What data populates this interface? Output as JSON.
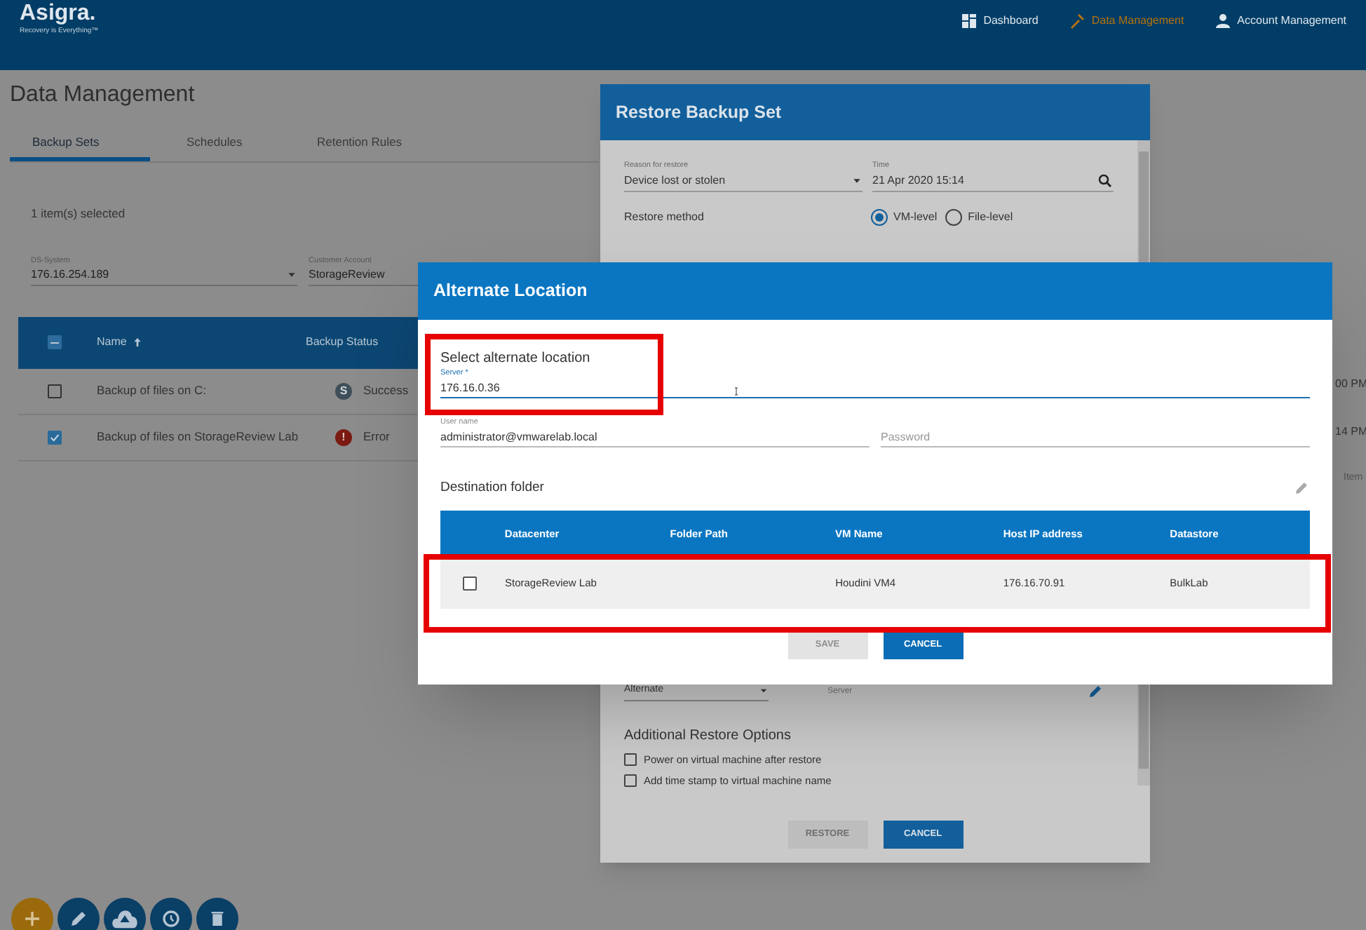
{
  "header": {
    "logo": "Asigra.",
    "tagline": "Recovery is Everything™",
    "nav": [
      {
        "label": "Dashboard",
        "kind": "grid",
        "selected": false
      },
      {
        "label": "Data Management",
        "kind": "tools",
        "selected": true
      },
      {
        "label": "Account Management",
        "kind": "person",
        "selected": false
      }
    ]
  },
  "page_title": "Data Management",
  "tabs": [
    {
      "label": "Backup Sets",
      "selected": true
    },
    {
      "label": "Schedules",
      "selected": false
    },
    {
      "label": "Retention Rules",
      "selected": false
    }
  ],
  "selection_count": "1 item(s) selected",
  "filters": [
    {
      "label": "DS-System",
      "value": "176.16.254.189",
      "kind": "dropdown"
    },
    {
      "label": "Customer Account",
      "value": "StorageReview",
      "kind": "text"
    }
  ],
  "table": {
    "header_checkbox": {
      "indeterminate": true
    },
    "columns": [
      {
        "label": "Name",
        "sorted": true
      },
      {
        "label": "Backup Status",
        "sorted": false
      }
    ],
    "rows": [
      {
        "selected": false,
        "name": "Backup of files on C:",
        "status": "Success",
        "kind": "success",
        "badge": "S",
        "time_fragment": "00 PM"
      },
      {
        "selected": true,
        "name": "Backup of files on StorageReview Lab",
        "status": "Error",
        "kind": "error",
        "badge": "!",
        "time_fragment": "14 PM"
      }
    ],
    "footer_fragment": "Item"
  },
  "actions": [
    {
      "kind": "add"
    },
    {
      "kind": "edit"
    },
    {
      "kind": "upload"
    },
    {
      "kind": "history"
    },
    {
      "kind": "delete"
    }
  ],
  "restore_dialog": {
    "title": "Restore Backup Set",
    "reason": {
      "label": "Reason for restore",
      "value": "Device lost or stolen"
    },
    "time": {
      "label": "Time",
      "value": "21 Apr 2020 15:14"
    },
    "method": {
      "label": "Restore method",
      "options": [
        {
          "label": "VM-level",
          "selected": true
        },
        {
          "label": "File-level",
          "selected": false
        }
      ]
    },
    "location": {
      "value": "Alternate",
      "server_label": "Server"
    },
    "options_title": "Additional Restore Options",
    "options": [
      {
        "label": "Power on virtual machine after restore",
        "checked": false
      },
      {
        "label": "Add time stamp to virtual machine name",
        "checked": false
      }
    ],
    "buttons": [
      {
        "label": "RESTORE",
        "disabled": true
      },
      {
        "label": "CANCEL",
        "disabled": false
      }
    ]
  },
  "alternate_dialog": {
    "title": "Alternate Location",
    "section": "Select alternate location",
    "server": {
      "label": "Server *",
      "value": "176.16.0.36"
    },
    "username": {
      "label": "User name",
      "value": "administrator@vmwarelab.local"
    },
    "password": {
      "placeholder": "Password"
    },
    "destination_title": "Destination folder",
    "columns": [
      "Datacenter",
      "Folder Path",
      "VM Name",
      "Host IP address",
      "Datastore"
    ],
    "rows": [
      {
        "checked": false,
        "cells": [
          "StorageReview Lab",
          "",
          "Houdini VM4",
          "176.16.70.91",
          "BulkLab"
        ]
      }
    ],
    "buttons": [
      {
        "label": "SAVE",
        "disabled": true
      },
      {
        "label": "CANCEL",
        "disabled": false
      }
    ]
  }
}
